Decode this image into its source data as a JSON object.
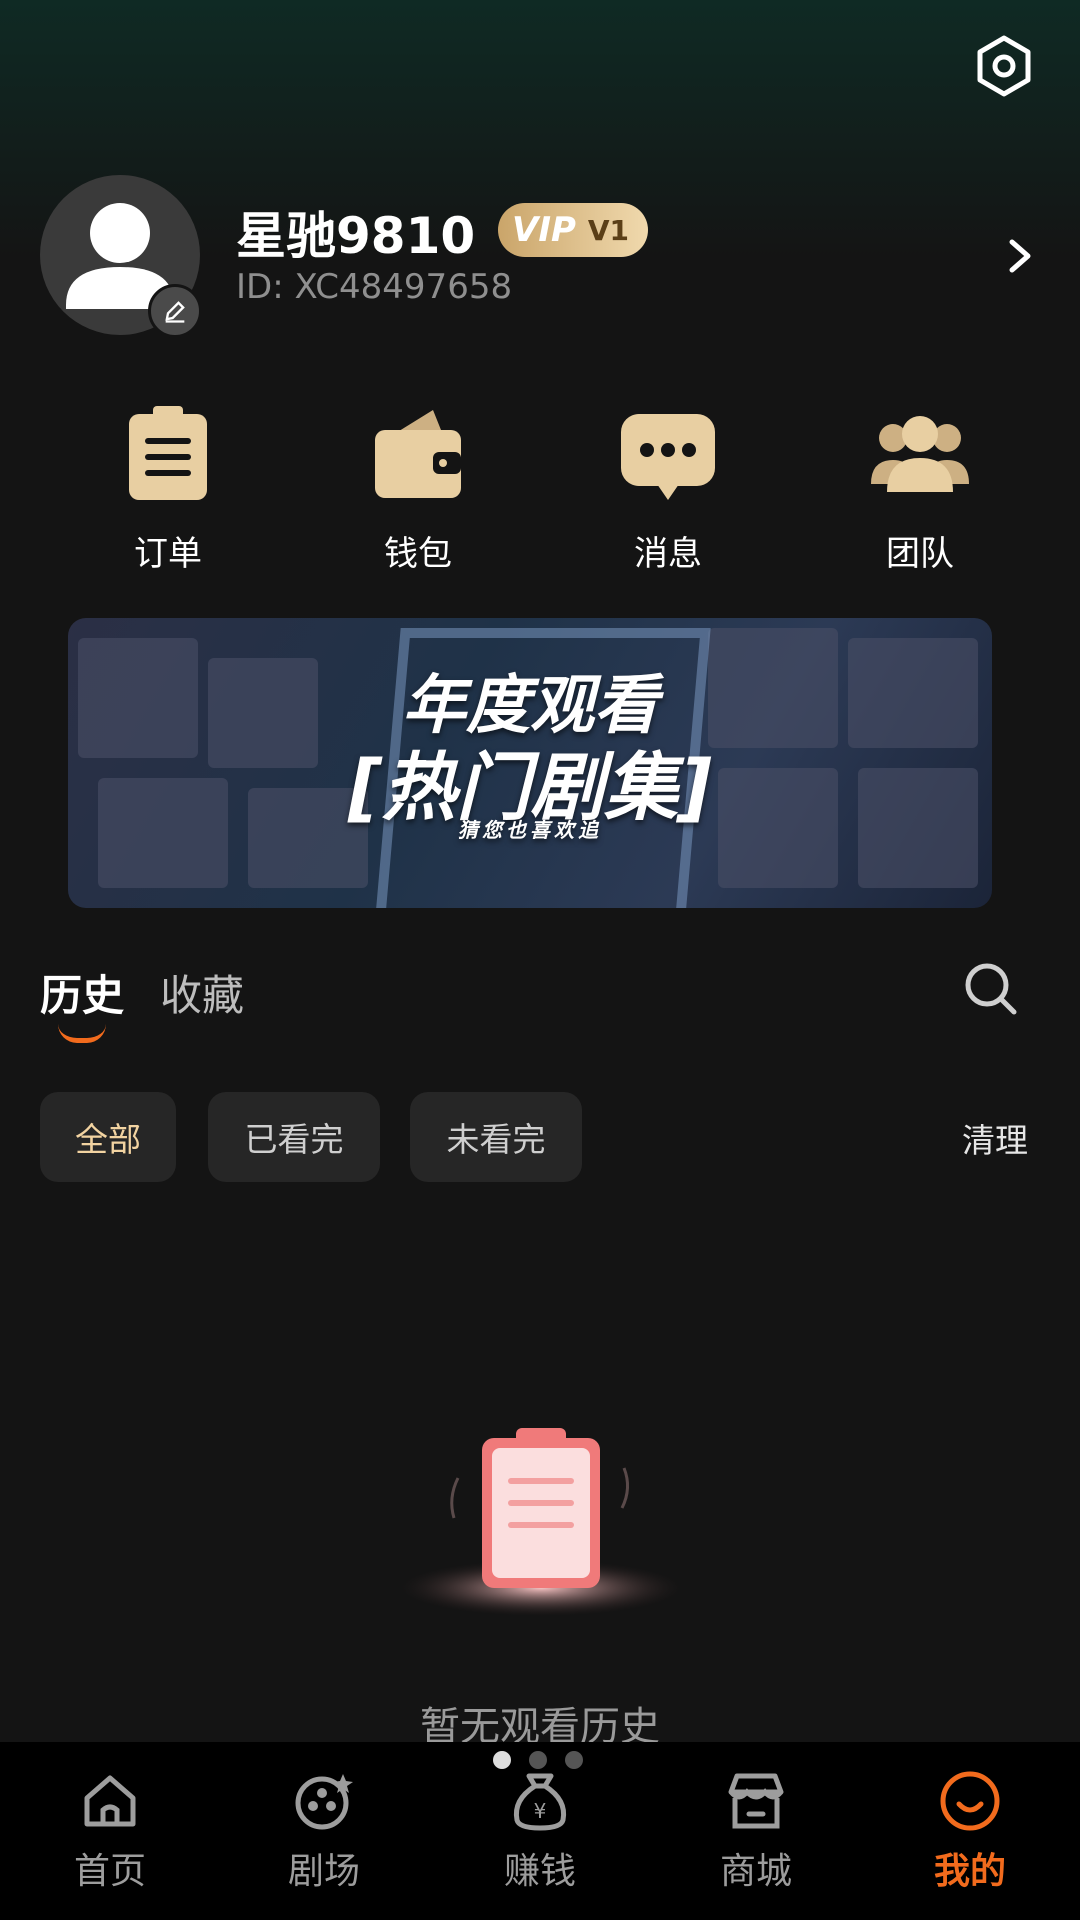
{
  "profile": {
    "username": "星驰9810",
    "vip_logo": "VIP",
    "vip_level": "V1",
    "user_id": "ID:  XC48497658"
  },
  "quick_menu": [
    {
      "label": "订单",
      "icon": "clipboard-icon"
    },
    {
      "label": "钱包",
      "icon": "wallet-icon"
    },
    {
      "label": "消息",
      "icon": "chat-bubble-icon"
    },
    {
      "label": "团队",
      "icon": "team-icon"
    }
  ],
  "banner": {
    "line1": "年度观看",
    "line2": "[热门剧集]",
    "line3": "猜您也喜欢追"
  },
  "tabs": [
    {
      "label": "历史",
      "active": true
    },
    {
      "label": "收藏",
      "active": false
    }
  ],
  "filters": [
    {
      "label": "全部",
      "active": true
    },
    {
      "label": "已看完",
      "active": false
    },
    {
      "label": "未看完",
      "active": false
    }
  ],
  "clean_label": "清理",
  "empty_state": {
    "text": "暂无观看历史"
  },
  "bottom_nav": [
    {
      "label": "首页",
      "icon": "home-icon",
      "active": false
    },
    {
      "label": "剧场",
      "icon": "theater-reel-icon",
      "active": false
    },
    {
      "label": "赚钱",
      "icon": "money-bag-icon",
      "active": false
    },
    {
      "label": "商城",
      "icon": "store-icon",
      "active": false
    },
    {
      "label": "我的",
      "icon": "smiley-profile-icon",
      "active": true
    }
  ],
  "colors": {
    "accent": "#f26b1d",
    "gold": "#e8cfa2",
    "background": "#141414"
  }
}
